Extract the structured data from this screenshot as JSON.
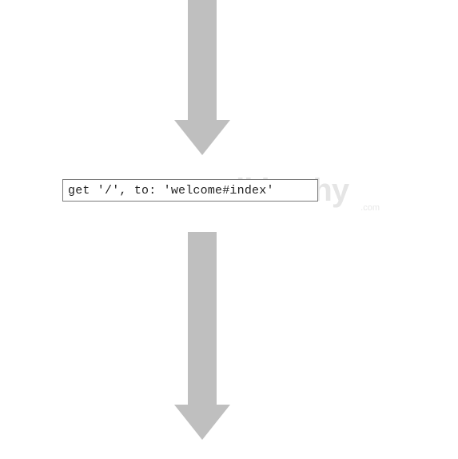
{
  "diagram": {
    "code_snippet": "get '/', to: 'welcome#index'",
    "arrow_top": {
      "shaft_width": 36,
      "shaft_height": 150,
      "head_half": 35,
      "head_height": 44
    },
    "arrow_bottom": {
      "shaft_width": 36,
      "shaft_height": 216,
      "head_half": 35,
      "head_height": 44
    }
  },
  "watermark": {
    "brand": "wikitechy",
    "suffix": ".com"
  }
}
